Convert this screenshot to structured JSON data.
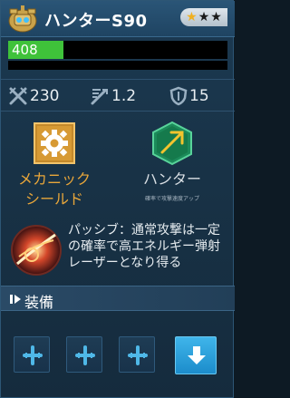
{
  "header": {
    "title": "ハンターS90",
    "stars_filled": 1,
    "stars_total": 3,
    "avatar_icon": "mech-avatar-icon"
  },
  "hp": {
    "value": "408",
    "fill_fraction": 0.25,
    "fill_color": "#3fc23a"
  },
  "stats": [
    {
      "icon": "attack-crossed-swords-icon",
      "value": "230"
    },
    {
      "icon": "attack-speed-icon",
      "value": "1.2"
    },
    {
      "icon": "shield-defense-icon",
      "value": "15"
    }
  ],
  "skills": [
    {
      "icon": "gear-icon",
      "label_line1": "メカニック",
      "label_line2": "シールド",
      "color": "#e8a63a"
    },
    {
      "icon": "arrow-up-icon",
      "label_line1": "ハンター",
      "sub": "確率で攻撃速度アップ",
      "color": "#d9dfe4"
    }
  ],
  "passive": {
    "icon": "energy-beam-icon",
    "text": "パッシブ：通常攻撃は一定の確率で高エネルギー弾射レーザーとなり得る"
  },
  "equipment": {
    "title": "装備",
    "slots": [
      "add-slot-icon",
      "add-slot-icon",
      "add-slot-icon"
    ],
    "download_icon": "download-arrow-icon"
  }
}
